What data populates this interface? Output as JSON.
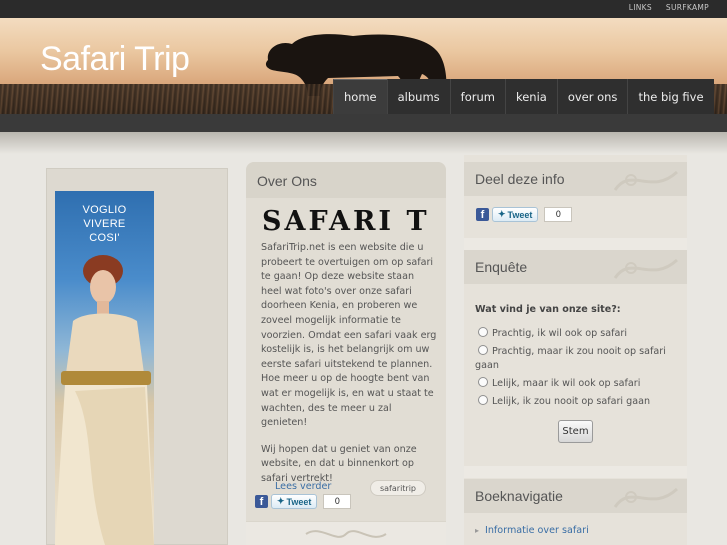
{
  "top_links": [
    "LINKS",
    "SURFKAMP"
  ],
  "site_title": "Safari Trip",
  "nav": [
    "home",
    "albums",
    "forum",
    "kenia",
    "over ons",
    "the big five"
  ],
  "ad": {
    "text_line1": "VOGLIO",
    "text_line2": "VIVERE",
    "text_line3": "COSI'"
  },
  "about": {
    "heading": "Over Ons",
    "logo_text": "SAFARI T",
    "paragraph1": "SafariTrip.net is een website die u probeert te overtuigen om op safari te gaan! Op deze website staan heel wat foto's over onze safari doorheen Kenia, en proberen we zoveel mogelijk informatie te voorzien. Omdat een safari vaak erg kostelijk is, is het belangrijk om uw eerste safari uitstekend te plannen. Hoe meer u op de hoogte bent van wat er mogelijk is, en wat u staat te wachten, des te meer u zal genieten!",
    "paragraph2": "Wij hopen dat u geniet van onze website, en dat u binnenkort op safari vertrekt!",
    "read_more": "Lees verder",
    "tag": "safaritrip"
  },
  "share": {
    "fb": "f",
    "tweet_label": "Tweet",
    "count": "0"
  },
  "sidebar": {
    "share_heading": "Deel deze info",
    "poll_heading": "Enquête",
    "poll_question": "Wat vind je van onze site?:",
    "poll_options": [
      "Prachtig, ik wil ook op safari",
      "Prachtig, maar ik zou nooit op safari gaan",
      "Lelijk, maar ik wil ook op safari",
      "Lelijk, ik zou nooit op safari gaan"
    ],
    "vote_button": "Stem",
    "book_heading": "Boeknavigatie",
    "book_link": "Informatie over safari"
  }
}
